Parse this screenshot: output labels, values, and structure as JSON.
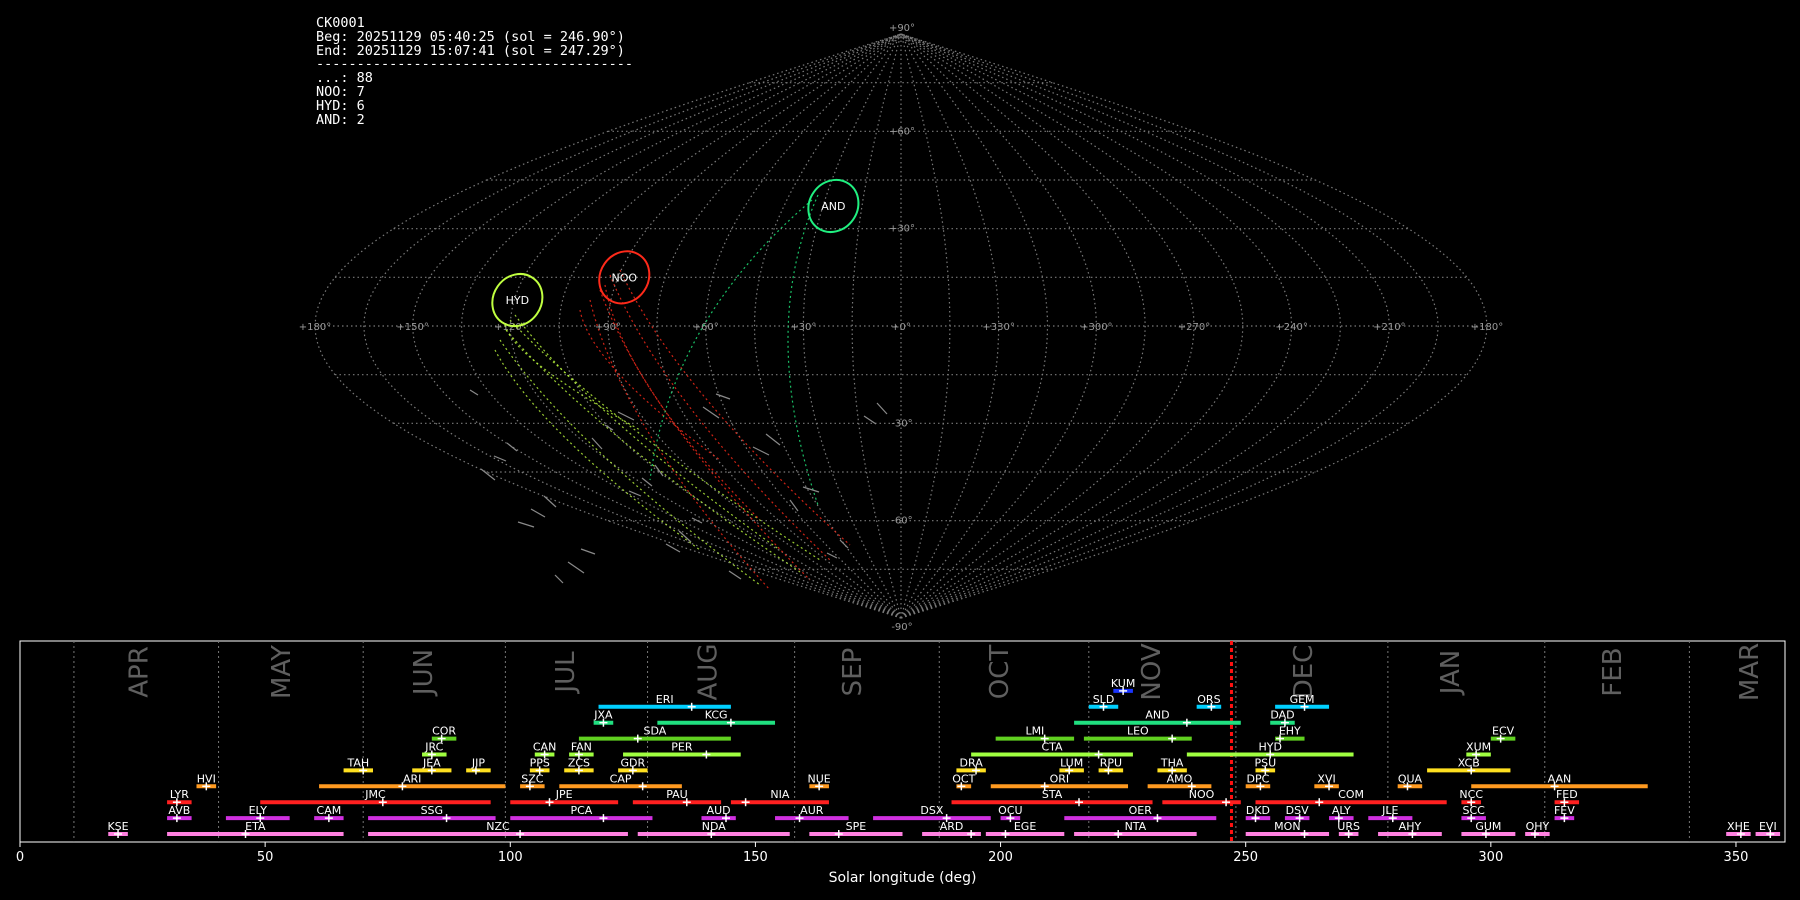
{
  "info_lines": [
    "CK0001",
    "Beg: 20251129 05:40:25 (sol = 246.90°)",
    "End: 20251129 15:07:41 (sol = 247.29°)",
    "---------------------------------------",
    "...: 88",
    "NOO: 7",
    "HYD: 6",
    "AND: 2"
  ],
  "sky_map": {
    "projection": "sinusoidal",
    "lon_labels": [
      "+180°",
      "+150°",
      "+120°",
      "+90°",
      "+60°",
      "+30°",
      "+0°",
      "+330°",
      "+300°",
      "+270°",
      "+240°",
      "+210°",
      "+180°"
    ],
    "lat_labels": [
      "+90°",
      "+60°",
      "+30°",
      "-30°",
      "-60°",
      "-90°"
    ],
    "shower_radiants": [
      {
        "code": "HYD",
        "color": "#c0ff40",
        "lon": 119,
        "lat": 8
      },
      {
        "code": "NOO",
        "color": "#ff2a1a",
        "lon": 88,
        "lat": 15
      },
      {
        "code": "AND",
        "color": "#20f080",
        "lon": 26,
        "lat": 37
      }
    ]
  },
  "chart_data": {
    "type": "timeline",
    "xlabel": "Solar longitude (deg)",
    "xlim": [
      0,
      360
    ],
    "xticks": [
      0,
      50,
      100,
      150,
      200,
      250,
      300,
      350
    ],
    "current_sol": 247.1,
    "months": [
      {
        "label": "APR",
        "sol": 24.5
      },
      {
        "label": "MAY",
        "sol": 53.5
      },
      {
        "label": "JUN",
        "sol": 82.5
      },
      {
        "label": "JUL",
        "sol": 111.5
      },
      {
        "label": "AUG",
        "sol": 140.5
      },
      {
        "label": "SEP",
        "sol": 170
      },
      {
        "label": "OCT",
        "sol": 200
      },
      {
        "label": "NOV",
        "sol": 231
      },
      {
        "label": "DEC",
        "sol": 262
      },
      {
        "label": "JAN",
        "sol": 292
      },
      {
        "label": "FEB",
        "sol": 325
      },
      {
        "label": "MAR",
        "sol": 353
      }
    ],
    "month_bounds": [
      11,
      40.5,
      70,
      99,
      128,
      158,
      187.5,
      218,
      248,
      279,
      311,
      340.5
    ],
    "showers": [
      {
        "code": "KUM",
        "start": 223,
        "end": 227,
        "peak": 225,
        "row": 10,
        "color": "#1a35ff"
      },
      {
        "code": "ERI",
        "start": 118,
        "end": 145,
        "peak": 137,
        "row": 9,
        "color": "#00d0ff"
      },
      {
        "code": "SLD",
        "start": 218,
        "end": 224,
        "peak": 221,
        "row": 9,
        "color": "#00d0ff"
      },
      {
        "code": "ORS",
        "start": 240,
        "end": 245,
        "peak": 243,
        "row": 9,
        "color": "#00d0ff"
      },
      {
        "code": "GEM",
        "start": 256,
        "end": 267,
        "peak": 262,
        "row": 9,
        "color": "#00d0ff"
      },
      {
        "code": "JXA",
        "start": 117,
        "end": 121,
        "peak": 119,
        "row": 8,
        "color": "#20e080"
      },
      {
        "code": "KCG",
        "start": 130,
        "end": 154,
        "peak": 145,
        "row": 8,
        "color": "#20e080"
      },
      {
        "code": "AND",
        "start": 215,
        "end": 249,
        "peak": 238,
        "row": 8,
        "color": "#20e080"
      },
      {
        "code": "DAD",
        "start": 255,
        "end": 260,
        "peak": 258,
        "row": 8,
        "color": "#20e080"
      },
      {
        "code": "COR",
        "start": 84,
        "end": 89,
        "peak": 86,
        "row": 7,
        "color": "#60d020"
      },
      {
        "code": "SDA",
        "start": 114,
        "end": 145,
        "peak": 126,
        "row": 7,
        "color": "#60d020"
      },
      {
        "code": "LMI",
        "start": 199,
        "end": 215,
        "peak": 209,
        "row": 7,
        "color": "#60d020"
      },
      {
        "code": "LEO",
        "start": 217,
        "end": 239,
        "peak": 235,
        "row": 7,
        "color": "#60d020"
      },
      {
        "code": "EHY",
        "start": 256,
        "end": 262,
        "peak": 257,
        "row": 7,
        "color": "#60d020"
      },
      {
        "code": "ECV",
        "start": 300,
        "end": 305,
        "peak": 302,
        "row": 7,
        "color": "#60d020"
      },
      {
        "code": "JRC",
        "start": 82,
        "end": 87,
        "peak": 84,
        "row": 6,
        "color": "#a0ff40"
      },
      {
        "code": "CAN",
        "start": 105,
        "end": 109,
        "peak": 107,
        "row": 6,
        "color": "#a0ff40"
      },
      {
        "code": "FAN",
        "start": 112,
        "end": 117,
        "peak": 114,
        "row": 6,
        "color": "#a0ff40"
      },
      {
        "code": "PER",
        "start": 123,
        "end": 147,
        "peak": 140,
        "row": 6,
        "color": "#a0ff40"
      },
      {
        "code": "CTA",
        "start": 194,
        "end": 227,
        "peak": 220,
        "row": 6,
        "color": "#a0ff40"
      },
      {
        "code": "HYD",
        "start": 238,
        "end": 272,
        "peak": 255,
        "row": 6,
        "color": "#a0ff40"
      },
      {
        "code": "XUM",
        "start": 295,
        "end": 300,
        "peak": 297,
        "row": 6,
        "color": "#a0ff40"
      },
      {
        "code": "TAH",
        "start": 66,
        "end": 72,
        "peak": 70,
        "row": 5,
        "color": "#ffe020"
      },
      {
        "code": "JEA",
        "start": 80,
        "end": 88,
        "peak": 84,
        "row": 5,
        "color": "#ffe020"
      },
      {
        "code": "JIP",
        "start": 91,
        "end": 96,
        "peak": 93,
        "row": 5,
        "color": "#ffe020"
      },
      {
        "code": "PPS",
        "start": 104,
        "end": 108,
        "peak": 106,
        "row": 5,
        "color": "#ffe020"
      },
      {
        "code": "ZCS",
        "start": 111,
        "end": 117,
        "peak": 114,
        "row": 5,
        "color": "#ffe020"
      },
      {
        "code": "GDR",
        "start": 122,
        "end": 128,
        "peak": 125,
        "row": 5,
        "color": "#ffe020"
      },
      {
        "code": "DRA",
        "start": 191,
        "end": 197,
        "peak": 195,
        "row": 5,
        "color": "#ffe020"
      },
      {
        "code": "LUM",
        "start": 212,
        "end": 217,
        "peak": 214,
        "row": 5,
        "color": "#ffe020"
      },
      {
        "code": "RPU",
        "start": 220,
        "end": 225,
        "peak": 222,
        "row": 5,
        "color": "#ffe020"
      },
      {
        "code": "THA",
        "start": 232,
        "end": 238,
        "peak": 235,
        "row": 5,
        "color": "#ffe020"
      },
      {
        "code": "PSU",
        "start": 252,
        "end": 256,
        "peak": 254,
        "row": 5,
        "color": "#ffe020"
      },
      {
        "code": "XCB",
        "start": 287,
        "end": 304,
        "peak": 296,
        "row": 5,
        "color": "#ffe020"
      },
      {
        "code": "HVI",
        "start": 36,
        "end": 40,
        "peak": 38,
        "row": 4,
        "color": "#ff9a20"
      },
      {
        "code": "ARI",
        "start": 61,
        "end": 99,
        "peak": 78,
        "row": 4,
        "color": "#ff9a20"
      },
      {
        "code": "SZC",
        "start": 102,
        "end": 107,
        "peak": 104,
        "row": 4,
        "color": "#ff9a20"
      },
      {
        "code": "CAP",
        "start": 110,
        "end": 135,
        "peak": 127,
        "row": 4,
        "color": "#ff9a20"
      },
      {
        "code": "NUE",
        "start": 161,
        "end": 165,
        "peak": 163,
        "row": 4,
        "color": "#ff9a20"
      },
      {
        "code": "OCT",
        "start": 191,
        "end": 194,
        "peak": 192,
        "row": 4,
        "color": "#ff9a20"
      },
      {
        "code": "ORI",
        "start": 198,
        "end": 226,
        "peak": 209,
        "row": 4,
        "color": "#ff9a20"
      },
      {
        "code": "AMO",
        "start": 230,
        "end": 243,
        "peak": 239,
        "row": 4,
        "color": "#ff9a20"
      },
      {
        "code": "DPC",
        "start": 250,
        "end": 255,
        "peak": 253,
        "row": 4,
        "color": "#ff9a20"
      },
      {
        "code": "XVI",
        "start": 264,
        "end": 269,
        "peak": 267,
        "row": 4,
        "color": "#ff9a20"
      },
      {
        "code": "QUA",
        "start": 281,
        "end": 286,
        "peak": 283,
        "row": 4,
        "color": "#ff9a20"
      },
      {
        "code": "AAN",
        "start": 296,
        "end": 332,
        "peak": 313,
        "row": 4,
        "color": "#ff9a20"
      },
      {
        "code": "LYR",
        "start": 30,
        "end": 35,
        "peak": 32,
        "row": 3,
        "color": "#ff2020"
      },
      {
        "code": "JMC",
        "start": 49,
        "end": 96,
        "peak": 74,
        "row": 3,
        "color": "#ff2020"
      },
      {
        "code": "JPE",
        "start": 100,
        "end": 122,
        "peak": 108,
        "row": 3,
        "color": "#ff2020"
      },
      {
        "code": "PAU",
        "start": 125,
        "end": 143,
        "peak": 136,
        "row": 3,
        "color": "#ff2020"
      },
      {
        "code": "NIA",
        "start": 145,
        "end": 165,
        "peak": 148,
        "row": 3,
        "color": "#ff2020"
      },
      {
        "code": "STA",
        "start": 190,
        "end": 231,
        "peak": 216,
        "row": 3,
        "color": "#ff2020"
      },
      {
        "code": "NOO",
        "start": 233,
        "end": 249,
        "peak": 246,
        "row": 3,
        "color": "#ff2020"
      },
      {
        "code": "COM",
        "start": 252,
        "end": 291,
        "peak": 265,
        "row": 3,
        "color": "#ff2020"
      },
      {
        "code": "NCC",
        "start": 294,
        "end": 298,
        "peak": 296,
        "row": 3,
        "color": "#ff2020"
      },
      {
        "code": "FED",
        "start": 313,
        "end": 318,
        "peak": 315,
        "row": 3,
        "color": "#ff2020"
      },
      {
        "code": "AVB",
        "start": 30,
        "end": 35,
        "peak": 32,
        "row": 2,
        "color": "#d030e0"
      },
      {
        "code": "ELY",
        "start": 42,
        "end": 55,
        "peak": 49,
        "row": 2,
        "color": "#d030e0"
      },
      {
        "code": "CAM",
        "start": 60,
        "end": 66,
        "peak": 63,
        "row": 2,
        "color": "#d030e0"
      },
      {
        "code": "SSG",
        "start": 71,
        "end": 97,
        "peak": 87,
        "row": 2,
        "color": "#d030e0"
      },
      {
        "code": "PCA",
        "start": 100,
        "end": 129,
        "peak": 119,
        "row": 2,
        "color": "#d030e0"
      },
      {
        "code": "AUD",
        "start": 139,
        "end": 146,
        "peak": 144,
        "row": 2,
        "color": "#d030e0"
      },
      {
        "code": "AUR",
        "start": 154,
        "end": 169,
        "peak": 159,
        "row": 2,
        "color": "#d030e0"
      },
      {
        "code": "DSX",
        "start": 174,
        "end": 198,
        "peak": 189,
        "row": 2,
        "color": "#d030e0"
      },
      {
        "code": "OCU",
        "start": 200,
        "end": 204,
        "peak": 202,
        "row": 2,
        "color": "#d030e0"
      },
      {
        "code": "OER",
        "start": 213,
        "end": 244,
        "peak": 232,
        "row": 2,
        "color": "#d030e0"
      },
      {
        "code": "DKD",
        "start": 250,
        "end": 255,
        "peak": 252,
        "row": 2,
        "color": "#d030e0"
      },
      {
        "code": "DSV",
        "start": 258,
        "end": 263,
        "peak": 261,
        "row": 2,
        "color": "#d030e0"
      },
      {
        "code": "ALY",
        "start": 267,
        "end": 272,
        "peak": 269,
        "row": 2,
        "color": "#d030e0"
      },
      {
        "code": "JLE",
        "start": 275,
        "end": 284,
        "peak": 280,
        "row": 2,
        "color": "#d030e0"
      },
      {
        "code": "SCC",
        "start": 294,
        "end": 299,
        "peak": 296,
        "row": 2,
        "color": "#d030e0"
      },
      {
        "code": "FEV",
        "start": 313,
        "end": 317,
        "peak": 315,
        "row": 2,
        "color": "#d030e0"
      },
      {
        "code": "KSE",
        "start": 18,
        "end": 22,
        "peak": 20,
        "row": 1,
        "color": "#ff80e0"
      },
      {
        "code": "ETA",
        "start": 30,
        "end": 66,
        "peak": 46,
        "row": 1,
        "color": "#ff80e0"
      },
      {
        "code": "NZC",
        "start": 71,
        "end": 124,
        "peak": 102,
        "row": 1,
        "color": "#ff80e0"
      },
      {
        "code": "NDA",
        "start": 126,
        "end": 157,
        "peak": 141,
        "row": 1,
        "color": "#ff80e0"
      },
      {
        "code": "SPE",
        "start": 161,
        "end": 180,
        "peak": 167,
        "row": 1,
        "color": "#ff80e0"
      },
      {
        "code": "ARD",
        "start": 184,
        "end": 196,
        "peak": 194,
        "row": 1,
        "color": "#ff80e0"
      },
      {
        "code": "EGE",
        "start": 197,
        "end": 213,
        "peak": 201,
        "row": 1,
        "color": "#ff80e0"
      },
      {
        "code": "NTA",
        "start": 215,
        "end": 240,
        "peak": 224,
        "row": 1,
        "color": "#ff80e0"
      },
      {
        "code": "MON",
        "start": 250,
        "end": 267,
        "peak": 262,
        "row": 1,
        "color": "#ff80e0"
      },
      {
        "code": "URS",
        "start": 269,
        "end": 273,
        "peak": 271,
        "row": 1,
        "color": "#ff80e0"
      },
      {
        "code": "AHY",
        "start": 277,
        "end": 290,
        "peak": 284,
        "row": 1,
        "color": "#ff80e0"
      },
      {
        "code": "GUM",
        "start": 294,
        "end": 305,
        "peak": 299,
        "row": 1,
        "color": "#ff80e0"
      },
      {
        "code": "OHY",
        "start": 307,
        "end": 312,
        "peak": 309,
        "row": 1,
        "color": "#ff80e0"
      },
      {
        "code": "XHE",
        "start": 348,
        "end": 353,
        "peak": 351,
        "row": 1,
        "color": "#ff80e0"
      },
      {
        "code": "EVI",
        "start": 354,
        "end": 359,
        "peak": 357,
        "row": 1,
        "color": "#ff80e0"
      }
    ]
  }
}
